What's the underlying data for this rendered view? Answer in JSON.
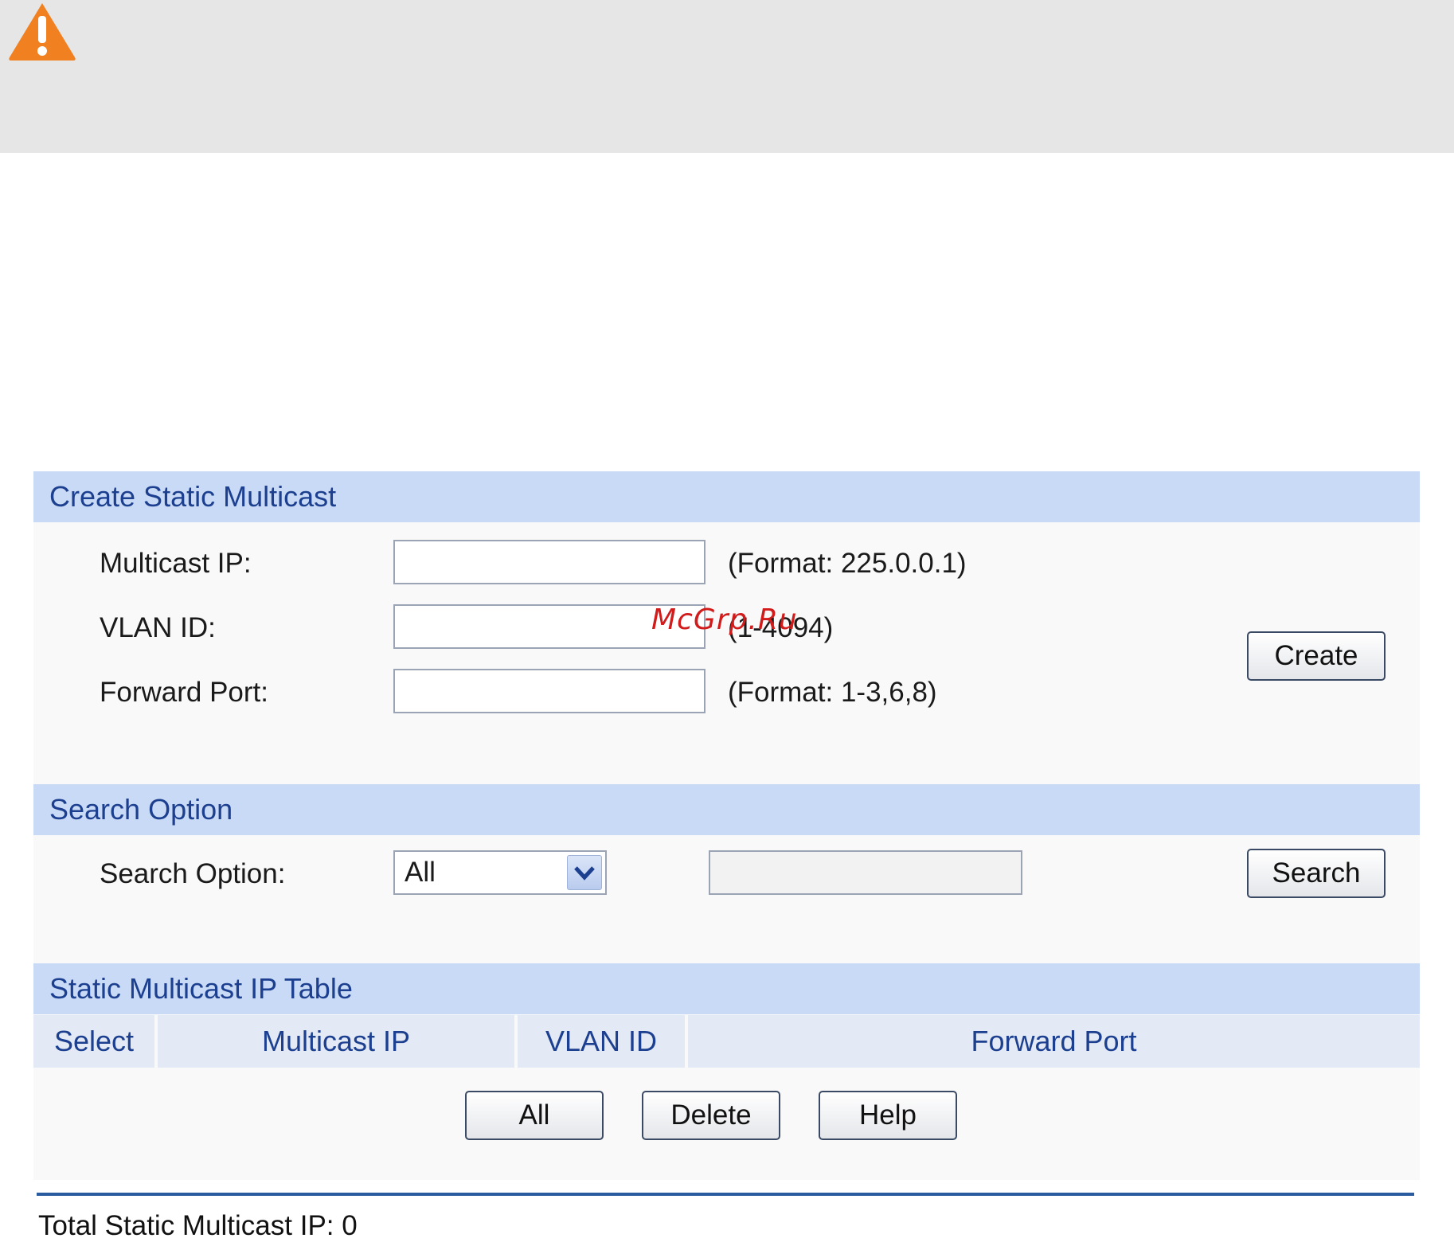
{
  "notice": {
    "icon": "warning-icon",
    "icon_color": "#f08020"
  },
  "create_section": {
    "title": "Create Static Multicast",
    "fields": [
      {
        "label": "Multicast IP:",
        "value": "",
        "hint": "(Format: 225.0.0.1)"
      },
      {
        "label": "VLAN ID:",
        "value": "",
        "hint": "(1-4094)"
      },
      {
        "label": "Forward Port:",
        "value": "",
        "hint": "(Format: 1-3,6,8)"
      }
    ],
    "create_button": "Create"
  },
  "search_section": {
    "title": "Search Option",
    "label": "Search Option:",
    "selected_option": "All",
    "search_value": "",
    "search_button": "Search"
  },
  "table_section": {
    "title": "Static Multicast IP Table",
    "columns": [
      "Select",
      "Multicast IP",
      "VLAN ID",
      "Forward Port"
    ],
    "rows": [],
    "buttons": {
      "all": "All",
      "delete": "Delete",
      "help": "Help"
    }
  },
  "footer": {
    "total_text": "Total Static Multicast IP: 0"
  },
  "watermark": "McGrp.Ru",
  "colors": {
    "section_header_bg": "#c9daf6",
    "section_header_text": "#1c3f8f",
    "notice_bg": "#e6e6e6",
    "footer_rule": "#2a5aa0",
    "watermark": "#d21b1b"
  }
}
